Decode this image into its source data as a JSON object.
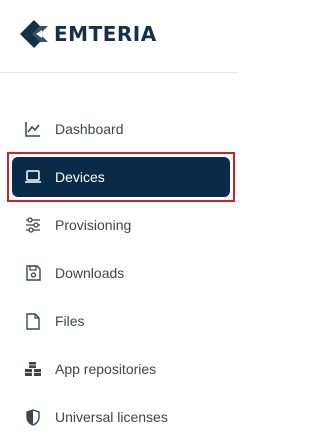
{
  "brand": {
    "name": "EMTERIA",
    "color": "#15304a"
  },
  "sidebar": {
    "items": [
      {
        "label": "Dashboard",
        "icon": "chart-line-icon",
        "active": false
      },
      {
        "label": "Devices",
        "icon": "laptop-icon",
        "active": true
      },
      {
        "label": "Provisioning",
        "icon": "sliders-icon",
        "active": false
      },
      {
        "label": "Downloads",
        "icon": "save-disk-icon",
        "active": false
      },
      {
        "label": "Files",
        "icon": "file-icon",
        "active": false
      },
      {
        "label": "App repositories",
        "icon": "cubes-icon",
        "active": false
      },
      {
        "label": "Universal licenses",
        "icon": "shield-icon",
        "active": false
      }
    ]
  },
  "colors": {
    "active_bg": "#0a2a4a",
    "highlight_border": "#d21f2c",
    "text": "#3c4650"
  }
}
